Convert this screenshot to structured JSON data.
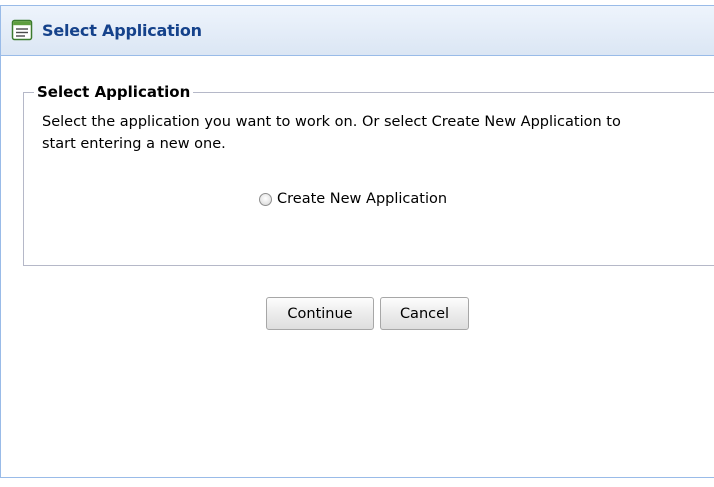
{
  "window": {
    "title": "Select Application",
    "icon": "form-icon"
  },
  "fieldset": {
    "legend": "Select Application",
    "description": "Select the application you want to work on. Or select Create New Application to start entering a new one."
  },
  "options": [
    {
      "label": "Create New Application",
      "selected": false
    }
  ],
  "buttons": {
    "continue_label": "Continue",
    "cancel_label": "Cancel"
  },
  "colors": {
    "title_text": "#15428b",
    "border": "#99bbe8",
    "fieldset_border": "#b5b8c8"
  }
}
